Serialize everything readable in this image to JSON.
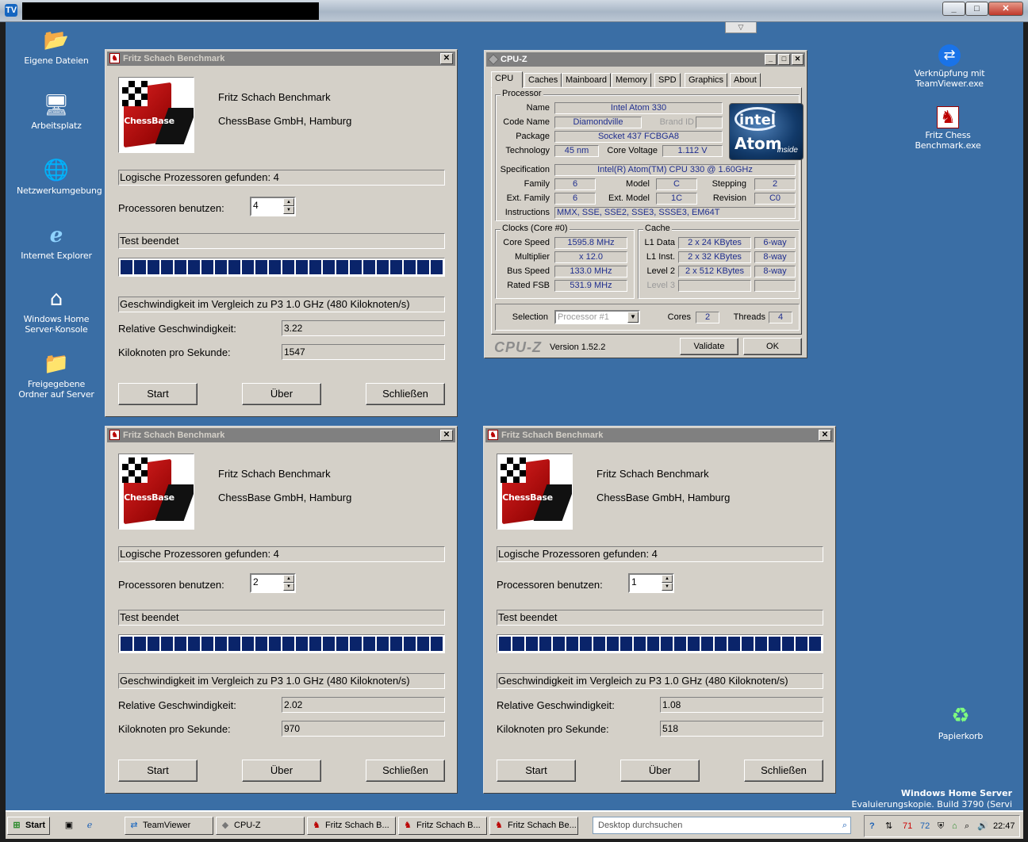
{
  "outer": {
    "tv_icon": "TV",
    "min": "_",
    "max": "□",
    "close": "✕",
    "tab_arrow": "▽"
  },
  "desktop_icons": [
    {
      "label": "Eigene Dateien",
      "icon": "📂"
    },
    {
      "label": "Arbeitsplatz",
      "icon": "🖥"
    },
    {
      "label": "Netzwerkumgebung",
      "icon": "🌐"
    },
    {
      "label": "Internet Explorer",
      "icon": "ℯ"
    },
    {
      "label": "Windows Home Server-Konsole",
      "icon": "⌂"
    },
    {
      "label": "Freigegebene Ordner auf Server",
      "icon": "📁"
    }
  ],
  "desktop_icons_right": [
    {
      "label": "Verknüpfung mit TeamViewer.exe",
      "icon": "⇄"
    },
    {
      "label": "Fritz Chess Benchmark.exe",
      "icon": "♞"
    },
    {
      "label": "Papierkorb",
      "icon": "♻"
    }
  ],
  "branding": {
    "product": "Windows Home Server",
    "eval": "Evaluierungskopie. Build 3790 (Servi"
  },
  "fritz_windows": [
    {
      "title": "Fritz Schach Benchmark",
      "logo_text": "ChessBase",
      "app_name": "Fritz Schach Benchmark",
      "company": "ChessBase GmbH, Hamburg",
      "log_procs": "Logische Prozessoren gefunden: 4",
      "use_procs_label": "Processoren benutzen:",
      "use_procs_value": "4",
      "status": "Test beendet",
      "progress": 1.0,
      "compare": "Geschwindigkeit im Vergleich zu P3 1.0 GHz (480 Kiloknoten/s)",
      "rel_label": "Relative Geschwindigkeit:",
      "rel_value": "3.22",
      "kn_label": "Kiloknoten pro Sekunde:",
      "kn_value": "1547",
      "btn_start": "Start",
      "btn_about": "Über",
      "btn_close": "Schließen"
    },
    {
      "title": "Fritz Schach Benchmark",
      "logo_text": "ChessBase",
      "app_name": "Fritz Schach Benchmark",
      "company": "ChessBase GmbH, Hamburg",
      "log_procs": "Logische Prozessoren gefunden: 4",
      "use_procs_label": "Processoren benutzen:",
      "use_procs_value": "2",
      "status": "Test beendet",
      "progress": 1.0,
      "compare": "Geschwindigkeit im Vergleich zu P3 1.0 GHz (480 Kiloknoten/s)",
      "rel_label": "Relative Geschwindigkeit:",
      "rel_value": "2.02",
      "kn_label": "Kiloknoten pro Sekunde:",
      "kn_value": "970",
      "btn_start": "Start",
      "btn_about": "Über",
      "btn_close": "Schließen"
    },
    {
      "title": "Fritz Schach Benchmark",
      "logo_text": "ChessBase",
      "app_name": "Fritz Schach Benchmark",
      "company": "ChessBase GmbH, Hamburg",
      "log_procs": "Logische Prozessoren gefunden: 4",
      "use_procs_label": "Processoren benutzen:",
      "use_procs_value": "1",
      "status": "Test beendet",
      "progress": 1.0,
      "compare": "Geschwindigkeit im Vergleich zu P3 1.0 GHz (480 Kiloknoten/s)",
      "rel_label": "Relative Geschwindigkeit:",
      "rel_value": "1.08",
      "kn_label": "Kiloknoten pro Sekunde:",
      "kn_value": "518",
      "btn_start": "Start",
      "btn_about": "Über",
      "btn_close": "Schließen"
    }
  ],
  "cpuz": {
    "title": "CPU-Z",
    "tabs": [
      "CPU",
      "Caches",
      "Mainboard",
      "Memory",
      "SPD",
      "Graphics",
      "About"
    ],
    "processor_group": "Processor",
    "name_label": "Name",
    "name": "Intel Atom 330",
    "codename_label": "Code Name",
    "codename": "Diamondville",
    "brandid_label": "Brand ID",
    "brandid": "",
    "package_label": "Package",
    "package": "Socket 437 FCBGA8",
    "tech_label": "Technology",
    "tech": "45 nm",
    "voltage_label": "Core Voltage",
    "voltage": "1.112 V",
    "spec_label": "Specification",
    "spec": "Intel(R) Atom(TM) CPU  330   @ 1.60GHz",
    "family_label": "Family",
    "family": "6",
    "model_label": "Model",
    "model": "C",
    "stepping_label": "Stepping",
    "stepping": "2",
    "extfamily_label": "Ext. Family",
    "extfamily": "6",
    "extmodel_label": "Ext. Model",
    "extmodel": "1C",
    "revision_label": "Revision",
    "revision": "C0",
    "instr_label": "Instructions",
    "instr": "MMX, SSE, SSE2, SSE3, SSSE3, EM64T",
    "logo_intel": "intel",
    "logo_atom": "Atom",
    "logo_inside": "inside",
    "clocks_group": "Clocks (Core #0)",
    "corespeed_label": "Core Speed",
    "corespeed": "1595.8 MHz",
    "multiplier_label": "Multiplier",
    "multiplier": "x 12.0",
    "busspeed_label": "Bus Speed",
    "busspeed": "133.0 MHz",
    "fsb_label": "Rated FSB",
    "fsb": "531.9 MHz",
    "cache_group": "Cache",
    "l1d_label": "L1 Data",
    "l1d": "2 x 24 KBytes",
    "l1d_way": "6-way",
    "l1i_label": "L1 Inst.",
    "l1i": "2 x 32 KBytes",
    "l1i_way": "8-way",
    "l2_label": "Level 2",
    "l2": "2 x 512 KBytes",
    "l2_way": "8-way",
    "l3_label": "Level 3",
    "selection_label": "Selection",
    "selection": "Processor #1",
    "cores_label": "Cores",
    "cores": "2",
    "threads_label": "Threads",
    "threads": "4",
    "brand": "CPU-Z",
    "version": "Version 1.52.2",
    "validate": "Validate",
    "ok": "OK"
  },
  "taskbar": {
    "start": "Start",
    "items": [
      {
        "label": "TeamViewer",
        "icon": "⇄"
      },
      {
        "label": "CPU-Z",
        "icon": "◆"
      },
      {
        "label": "Fritz Schach B...",
        "icon": "♞"
      },
      {
        "label": "Fritz Schach B...",
        "icon": "♞"
      },
      {
        "label": "Fritz Schach Be...",
        "icon": "♞"
      }
    ],
    "search_placeholder": "Desktop durchsuchen",
    "tray_nums": [
      "71",
      "72"
    ],
    "clock": "22:47"
  }
}
